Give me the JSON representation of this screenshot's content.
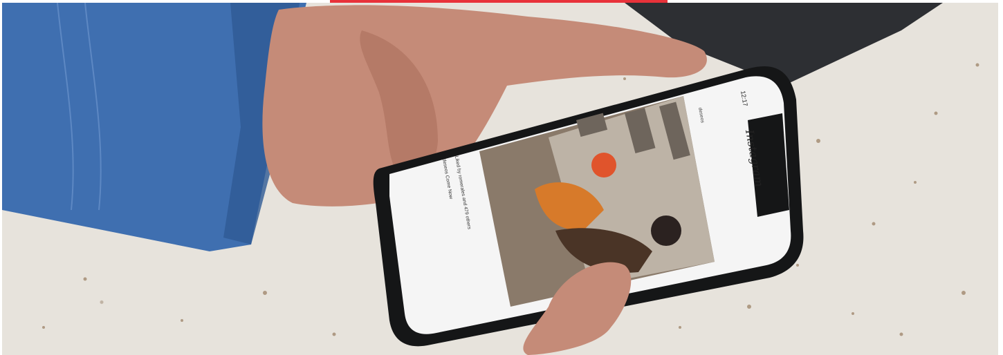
{
  "colors": {
    "accent_bar": "#e8323a",
    "countertop": "#e7e3dc",
    "sleeve": "#3f6fb0"
  },
  "phone": {
    "status_time": "12:17",
    "app_name": "Instagram",
    "story_user": "deseos",
    "caption_liked": "Liked by romerales and 479 others",
    "caption_user": "deseos Come Now"
  }
}
